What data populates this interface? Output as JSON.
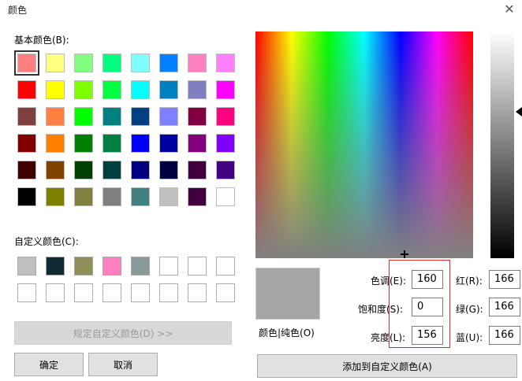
{
  "window": {
    "title": "颜色",
    "close_symbol": "✕"
  },
  "basic_colors": {
    "label": "基本颜色(B):",
    "rows": [
      [
        "#ff8080",
        "#ffff80",
        "#80ff80",
        "#00ff80",
        "#80ffff",
        "#0080ff",
        "#ff80c0",
        "#ff80ff"
      ],
      [
        "#ff0000",
        "#ffff00",
        "#80ff00",
        "#00ff40",
        "#00ffff",
        "#0080c0",
        "#8080c0",
        "#ff00ff"
      ],
      [
        "#804040",
        "#ff8040",
        "#00ff00",
        "#008080",
        "#004080",
        "#8080ff",
        "#800040",
        "#ff0080"
      ],
      [
        "#800000",
        "#ff8000",
        "#008000",
        "#008040",
        "#0000ff",
        "#0000a0",
        "#800080",
        "#8000ff"
      ],
      [
        "#400000",
        "#804000",
        "#004000",
        "#004040",
        "#000080",
        "#000040",
        "#400040",
        "#400080"
      ],
      [
        "#000000",
        "#808000",
        "#808040",
        "#808080",
        "#408080",
        "#c0c0c0",
        "#400040",
        "#ffffff"
      ]
    ],
    "selected_index": 0
  },
  "custom_colors": {
    "label": "自定义颜色(C):",
    "rows": [
      [
        "#bfbfbf",
        "#0f2a30",
        "#8f8f5a",
        "#ff80c0",
        "#8a9a9a",
        "#ffffff",
        "#ffffff",
        "#ffffff"
      ],
      [
        "#ffffff",
        "#ffffff",
        "#ffffff",
        "#ffffff",
        "#ffffff",
        "#ffffff",
        "#ffffff",
        "#ffffff"
      ]
    ]
  },
  "define_custom_button": "规定自定义颜色(D) >>",
  "ok_button": "确定",
  "cancel_button": "取消",
  "preview_label": "颜色|纯色(O)",
  "preview_color": "#a6a6a6",
  "hsl": {
    "hue_label": "色调(E):",
    "hue": "160",
    "sat_label": "饱和度(S):",
    "sat": "0",
    "lum_label": "亮度(L):",
    "lum": "156"
  },
  "rgb": {
    "red_label": "红(R):",
    "red": "166",
    "green_label": "绿(G):",
    "green": "166",
    "blue_label": "蓝(U):",
    "blue": "166"
  },
  "add_custom_button": "添加到自定义颜色(A)"
}
